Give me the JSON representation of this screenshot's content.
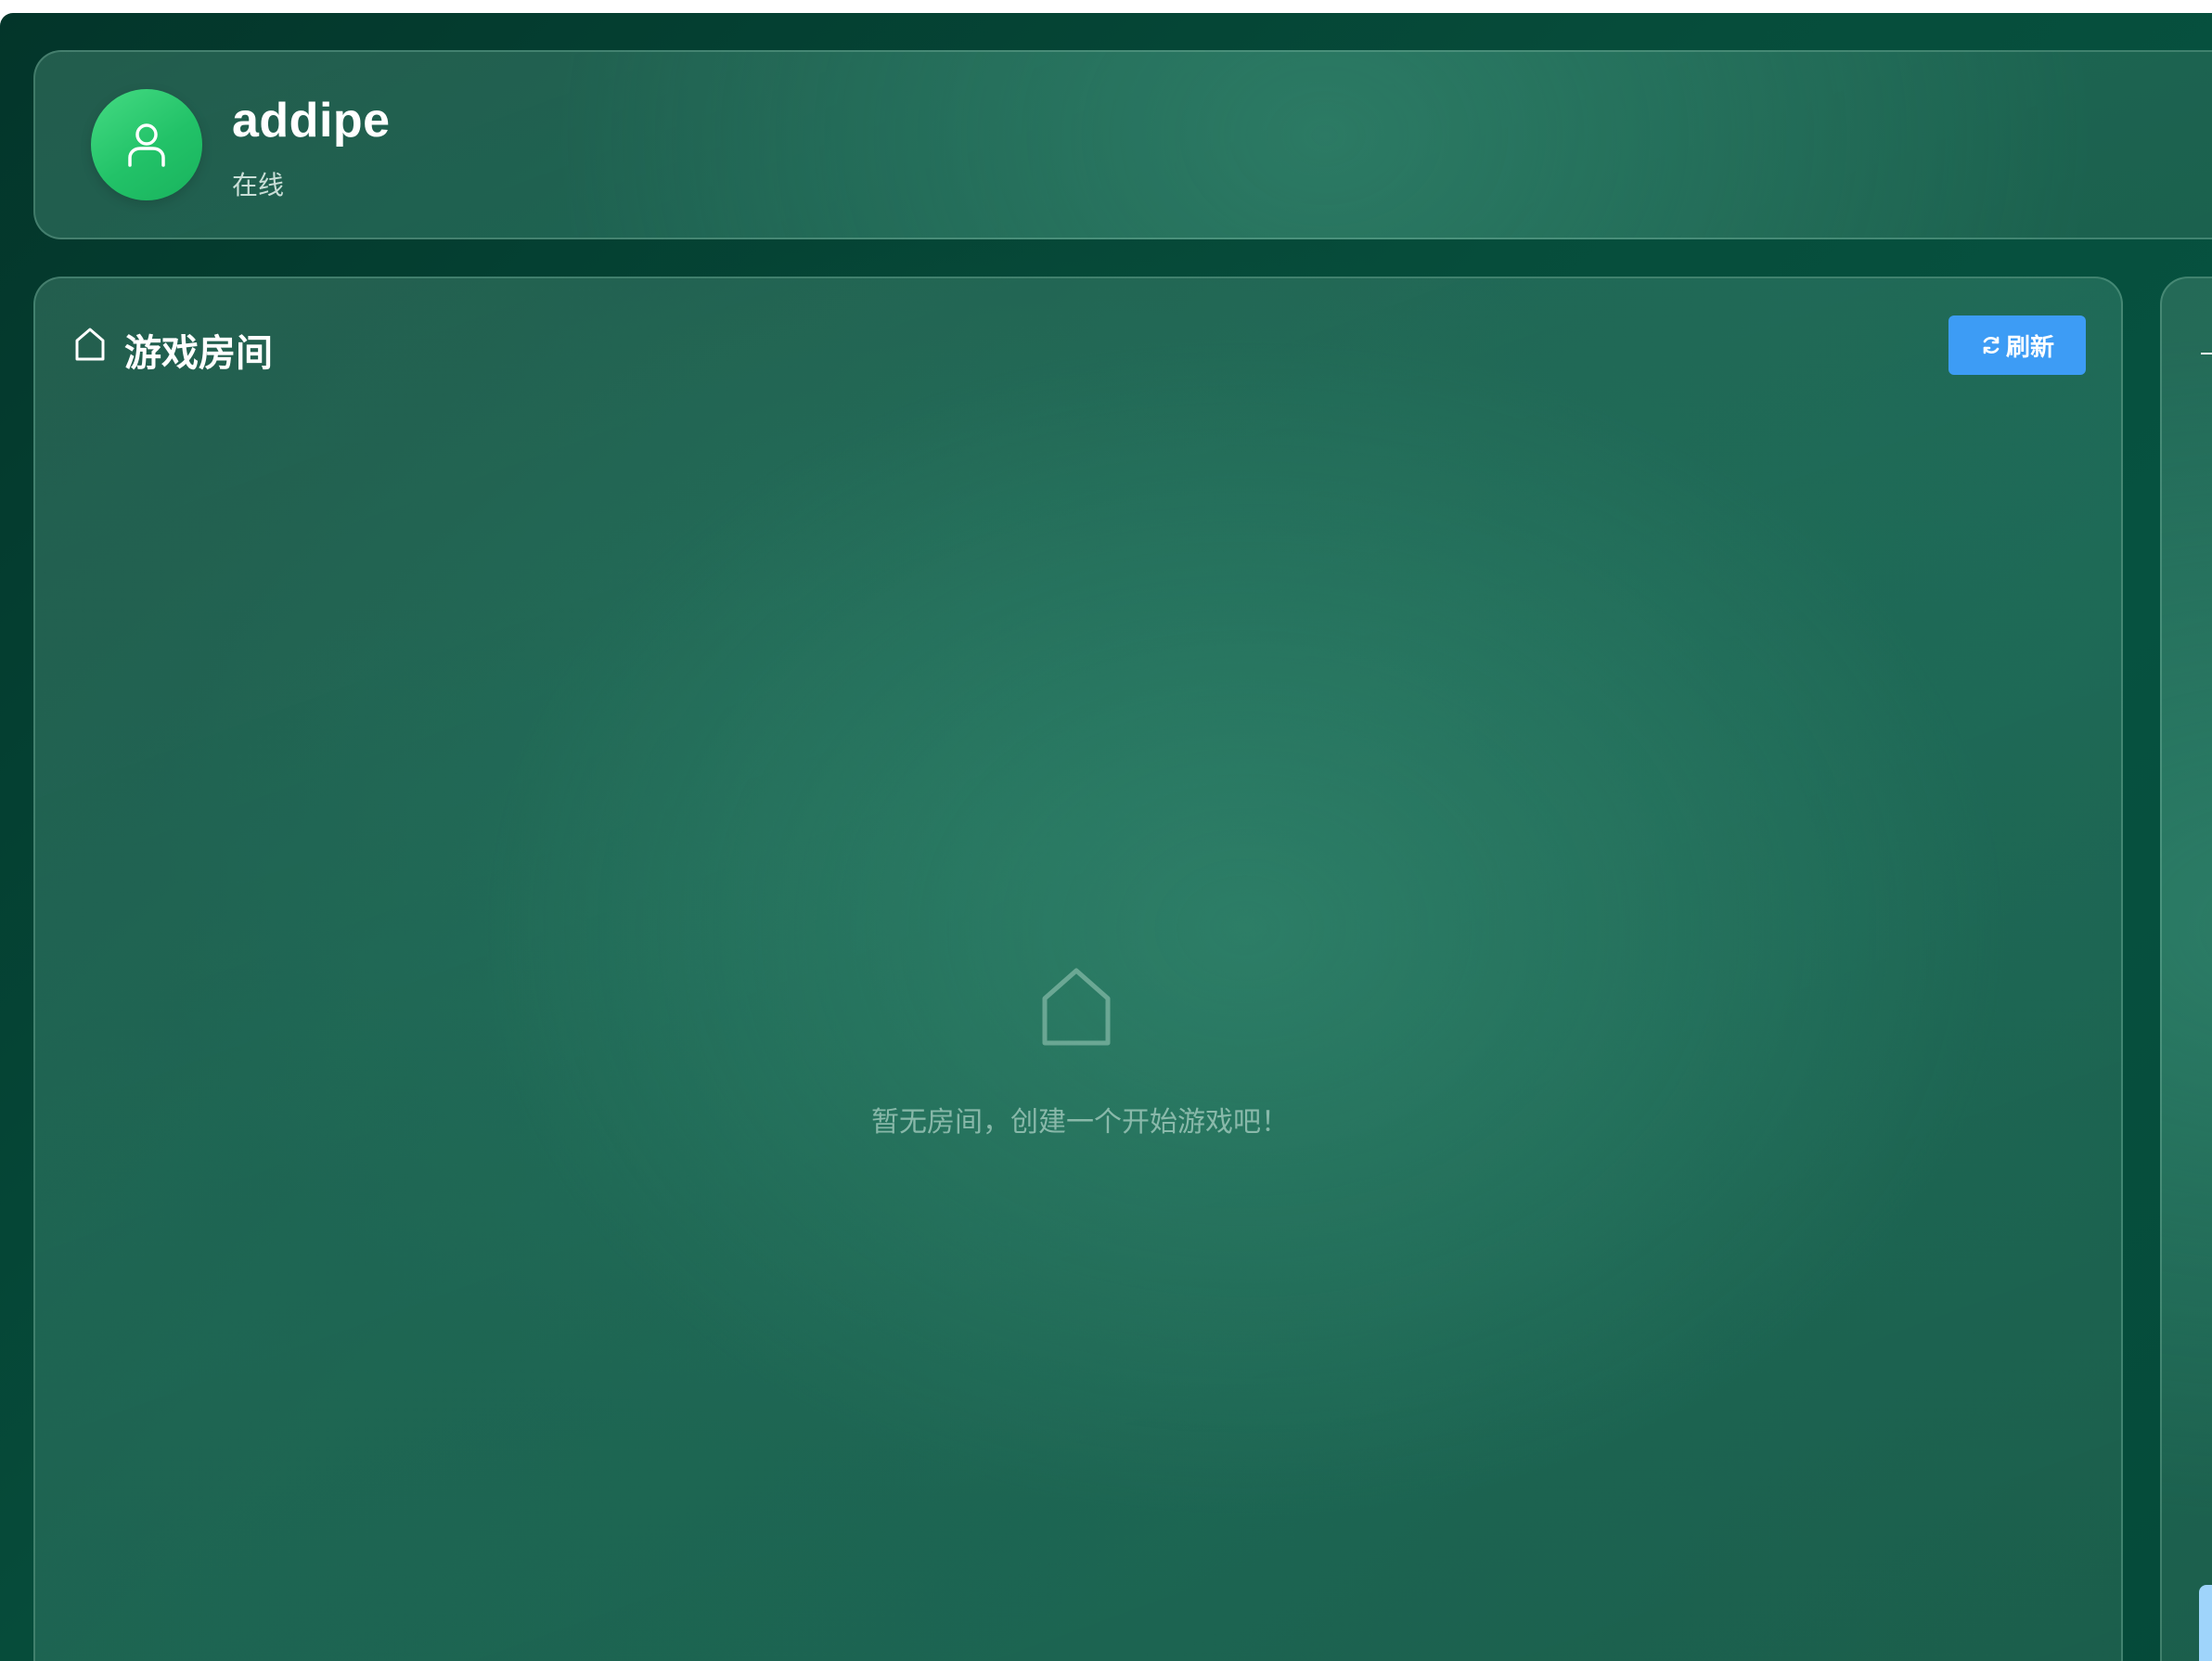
{
  "user": {
    "name": "addipe",
    "status": "在线",
    "avatar_icon": "user-icon",
    "avatar_color": "#22c268"
  },
  "rooms": {
    "title_icon": "home-icon",
    "title": "游戏房间",
    "refresh_icon": "refresh-icon",
    "refresh_label": "刷新",
    "refresh_color": "#3d9cf5",
    "empty_icon": "home-icon",
    "empty_message": "暂无房间，创建一个开始游戏吧！"
  },
  "theme": {
    "background": "#064d3b",
    "accent": "#3d9cf5"
  }
}
